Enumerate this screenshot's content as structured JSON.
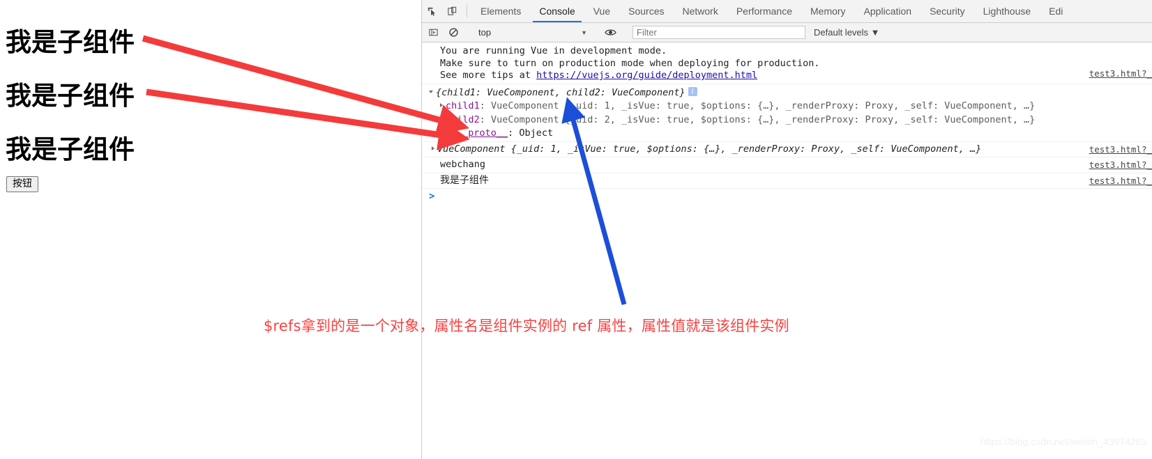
{
  "page": {
    "headings": [
      "我是子组件",
      "我是子组件",
      "我是子组件"
    ],
    "button_label": "按钮"
  },
  "devtools": {
    "tabs": [
      {
        "label": "Elements",
        "selected": false
      },
      {
        "label": "Console",
        "selected": true
      },
      {
        "label": "Vue",
        "selected": false
      },
      {
        "label": "Sources",
        "selected": false
      },
      {
        "label": "Network",
        "selected": false
      },
      {
        "label": "Performance",
        "selected": false
      },
      {
        "label": "Memory",
        "selected": false
      },
      {
        "label": "Application",
        "selected": false
      },
      {
        "label": "Security",
        "selected": false
      },
      {
        "label": "Lighthouse",
        "selected": false
      },
      {
        "label": "Edi",
        "selected": false
      }
    ],
    "icons": {
      "inspect": "inspect-element-icon",
      "device": "device-toolbar-icon",
      "sidebar": "console-sidebar-icon",
      "clear": "clear-console-icon",
      "eye": "live-expression-eye-icon"
    },
    "filterbar": {
      "context_value": "top",
      "context_caret": "▼",
      "filter_placeholder": "Filter",
      "filter_value": "",
      "levels_label": "Default levels",
      "levels_caret": "▼"
    },
    "console": {
      "vue_banner": [
        "You are running Vue in development mode.",
        "Make sure to turn on production mode when deploying for production.",
        "See more tips at "
      ],
      "vue_banner_link": "https://vuejs.org/guide/deployment.html",
      "banner_source": "test3.html?_",
      "obj_header": "{child1: VueComponent, child2: VueComponent}",
      "obj_info_badge": "i",
      "child1": {
        "key": "child1",
        "rest": ": VueComponent {_uid: 1, _isVue: true, $options: {…}, _renderProxy: Proxy, _self: VueComponent, …}",
        "uid": "1",
        "isvue": "true"
      },
      "child2": {
        "key": "child2",
        "rest": ": VueComponent {_uid: 2, _isVue: true, $options: {…}, _renderProxy: Proxy, _self: VueComponent, …}",
        "uid": "2",
        "isvue": "true"
      },
      "proto_label": "__proto__",
      "proto_value": ": Object",
      "vuecomponent_line": "VueComponent {_uid: 1, _isVue: true, $options: {…}, _renderProxy: Proxy, _self: VueComponent, …}",
      "vuecomponent_source": "test3.html?_",
      "log_webchang": "webchang",
      "log_webchang_source": "test3.html?_",
      "log_child": "我是子组件",
      "log_child_source": "test3.html?_",
      "prompt": ">"
    }
  },
  "annotations": {
    "note": "$refs拿到的是一个对象，属性名是组件实例的 ref 属性，属性值就是该组件实例",
    "note_color": "#fc4040",
    "red_arrow_color": "#f43b3b",
    "blue_arrow_color": "#1c4fd8",
    "watermark": "https://blog.csdn.net/weixin_43974265"
  }
}
